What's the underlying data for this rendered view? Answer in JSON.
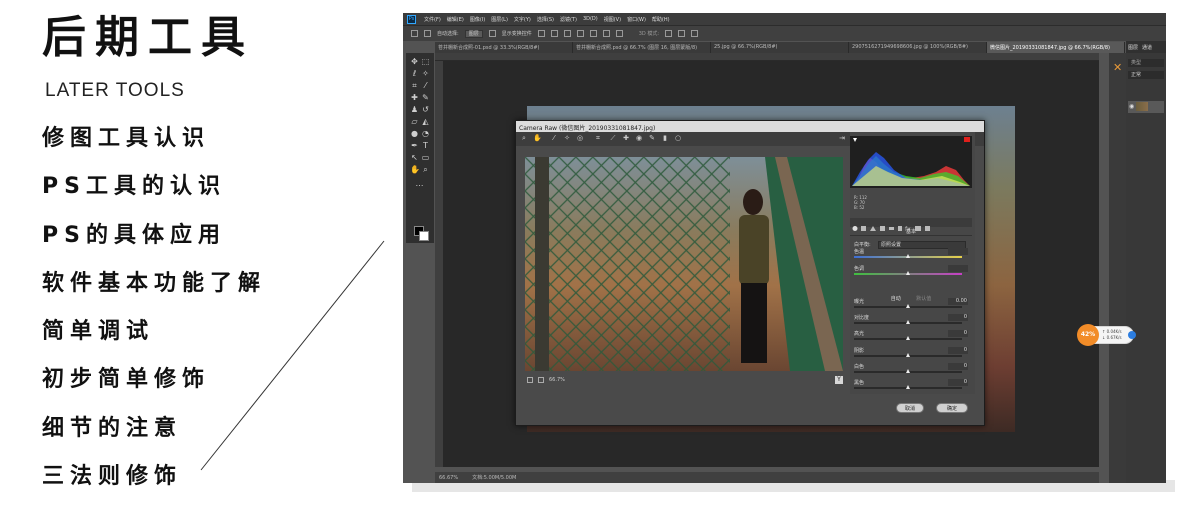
{
  "header": {
    "title": "后期工具",
    "subtitle": "LATER TOOLS"
  },
  "topics": [
    "修图工具认识",
    "PS工具的认识",
    "PS的具体应用",
    "软件基本功能了解",
    "简单调试",
    "初步简单修饰",
    "细节的注意",
    "三法则修饰"
  ],
  "photoshop": {
    "app_icon": "Ps",
    "menus": [
      "文件(F)",
      "编辑(E)",
      "图像(I)",
      "图层(L)",
      "文字(Y)",
      "选择(S)",
      "滤镜(T)",
      "3D(D)",
      "视图(V)",
      "窗口(W)",
      "帮助(H)"
    ],
    "options_bar": {
      "auto_select_label": "自动选择:",
      "auto_select_value": "图层",
      "show_transform_label": "显示变换控件",
      "mode_3d_label": "3D 模式:"
    },
    "tabs": [
      "苍井棚新合成照-01.psd @ 33.3%(RGB/8#)",
      "苍井棚新合成照.psd @ 66.7% (图层 16, 图层蒙版/8)",
      "25.jpg @ 66.7%(RGB/8#)",
      "2907516271949698606.jpg @ 100%(RGB/8#)",
      "微信图片_20190331081847.jpg @ 66.7%(RGB/8)"
    ],
    "active_tab_index": 4,
    "status": {
      "zoom": "66.67%",
      "doc_info": "文档:5.00M/5.00M"
    },
    "panel_tabs": [
      "图层",
      "通道"
    ],
    "layer_kind_placeholder": "类型",
    "layer_blend_mode": "正常",
    "colors": {
      "app_bg": "#535353",
      "canvas_bg": "#282828",
      "menubar": "#3c3c3c",
      "accent": "#31a8ff"
    }
  },
  "camera_raw": {
    "title": "Camera Raw (微信图片_20190331081847.jpg)",
    "zoom": "66.7%",
    "preview_mode_button": "Y",
    "readout": {
      "r_label": "R:",
      "r": "112",
      "g_label": "G:",
      "g": "70",
      "b_label": "B:",
      "b": "52"
    },
    "section_title": "基本",
    "white_balance_label": "白平衡:",
    "white_balance_value": "原照设置",
    "auto_label": "自动",
    "default_label": "默认值",
    "sliders": [
      {
        "label": "色温",
        "value": "",
        "pos": 0.5
      },
      {
        "label": "色调",
        "value": "",
        "pos": 0.5
      },
      {
        "label": "曝光",
        "value": "0.00",
        "pos": 0.5
      },
      {
        "label": "对比度",
        "value": "0",
        "pos": 0.5
      },
      {
        "label": "高光",
        "value": "0",
        "pos": 0.5
      },
      {
        "label": "阴影",
        "value": "0",
        "pos": 0.5
      },
      {
        "label": "白色",
        "value": "0",
        "pos": 0.5
      },
      {
        "label": "黑色",
        "value": "0",
        "pos": 0.5
      }
    ],
    "buttons": {
      "cancel": "取消",
      "ok": "确定"
    }
  },
  "net_meter": {
    "percent": "42%",
    "upload": "↑ 0.04K/s",
    "download": "↓ 0.67K/s",
    "color": "#f28c28"
  }
}
